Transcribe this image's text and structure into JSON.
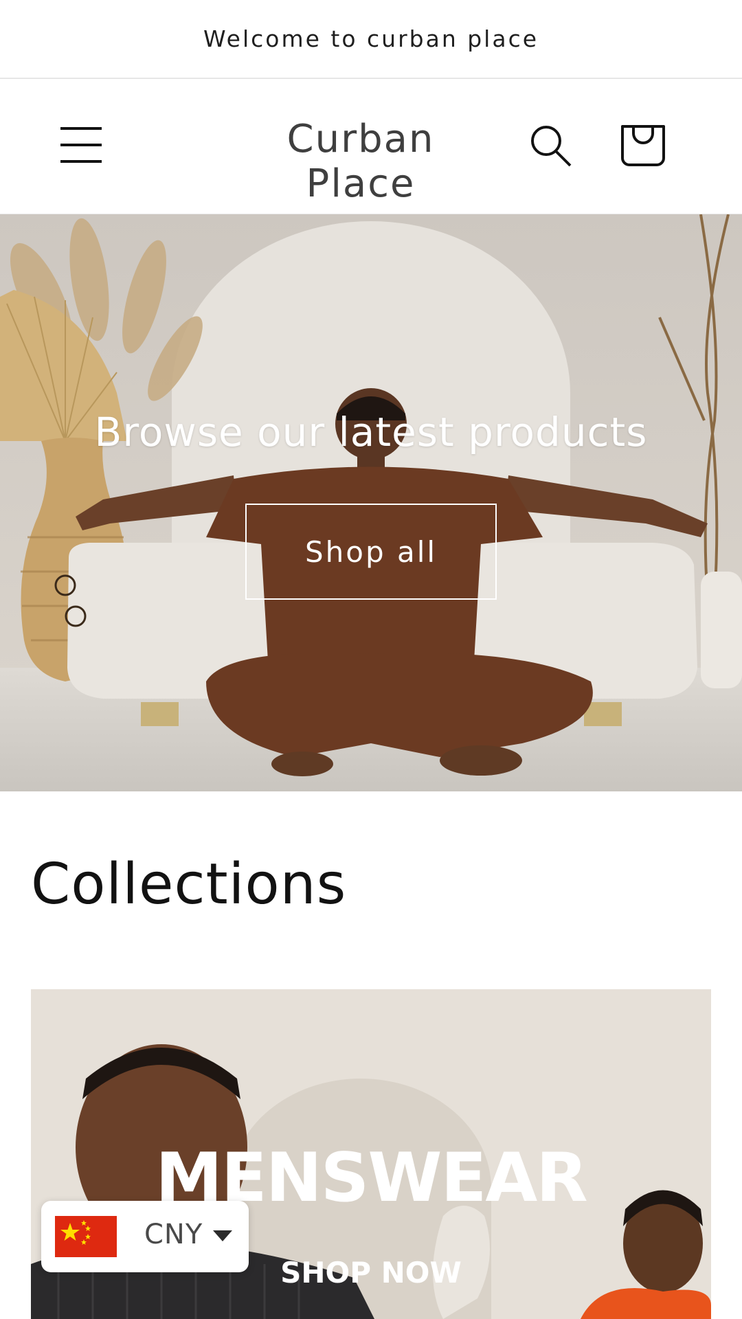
{
  "announcement": {
    "text": "Welcome to curban place"
  },
  "header": {
    "brand": "Curban Place",
    "menu_icon": "hamburger-menu-icon",
    "search_icon": "search-icon",
    "cart_icon": "cart-bag-icon"
  },
  "hero": {
    "title": "Browse our latest products",
    "button_label": "Shop all"
  },
  "collections": {
    "heading": "Collections",
    "card": {
      "title": "MENSWEAR",
      "cta": "SHOP NOW"
    }
  },
  "currency": {
    "code": "CNY",
    "flag_icon": "china-flag-icon",
    "caret_icon": "caret-down-icon"
  },
  "colors": {
    "text_primary": "#121212",
    "brand_text": "#3f3f3f",
    "flag_red": "#de2910",
    "flag_yellow": "#ffde00",
    "outfit_brown": "#6b3a22"
  }
}
